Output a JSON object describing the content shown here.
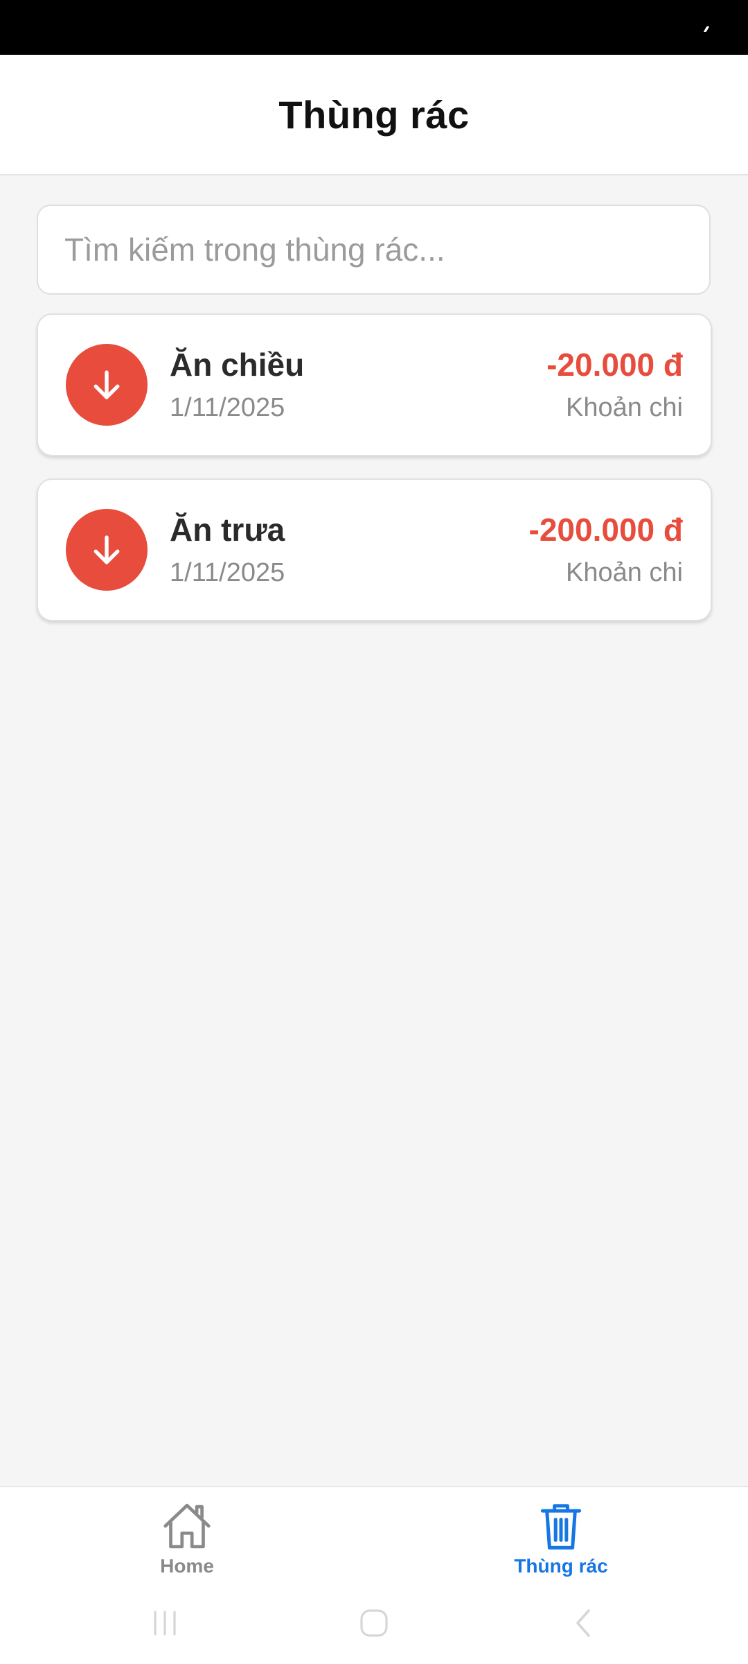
{
  "header": {
    "title": "Thùng rác"
  },
  "search": {
    "placeholder": "Tìm kiếm trong thùng rác..."
  },
  "colors": {
    "expense": "#e74c3c",
    "active_nav": "#1676e3",
    "inactive_nav": "#8a8a8a"
  },
  "transactions": [
    {
      "title": "Ăn chiều",
      "date": "1/11/2025",
      "amount": "-20.000 đ",
      "type": "Khoản chi",
      "icon": "arrow-down-icon"
    },
    {
      "title": "Ăn trưa",
      "date": "1/11/2025",
      "amount": "-200.000 đ",
      "type": "Khoản chi",
      "icon": "arrow-down-icon"
    }
  ],
  "bottom_nav": [
    {
      "label": "Home",
      "icon": "home-icon",
      "active": false
    },
    {
      "label": "Thùng rác",
      "icon": "trash-icon",
      "active": true
    }
  ],
  "system_nav": [
    "recents-icon",
    "home-button-icon",
    "back-icon"
  ]
}
